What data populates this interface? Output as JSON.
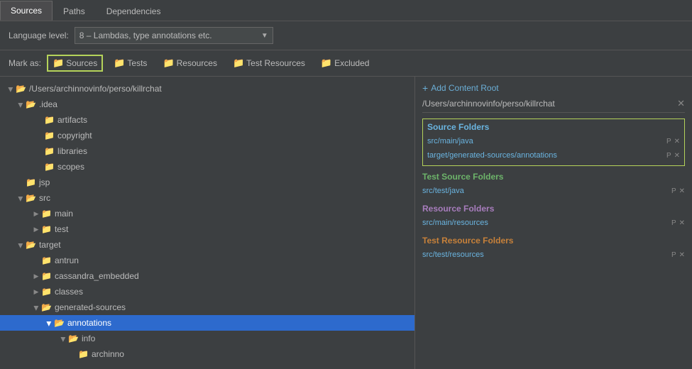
{
  "tabs": [
    {
      "label": "Sources",
      "active": true
    },
    {
      "label": "Paths",
      "active": false
    },
    {
      "label": "Dependencies",
      "active": false
    }
  ],
  "language": {
    "label": "Language level:",
    "value": "8 – Lambdas, type annotations etc."
  },
  "mark_as": {
    "label": "Mark as:",
    "buttons": [
      {
        "id": "sources",
        "label": "Sources",
        "active": true
      },
      {
        "id": "tests",
        "label": "Tests",
        "active": false
      },
      {
        "id": "resources",
        "label": "Resources",
        "active": false
      },
      {
        "id": "test_resources",
        "label": "Test Resources",
        "active": false
      },
      {
        "id": "excluded",
        "label": "Excluded",
        "active": false
      }
    ]
  },
  "tree": {
    "root": "/Users/archinnovinfo/perso/killrchat",
    "items": [
      {
        "id": "root",
        "label": "/Users/archinnovinfo/perso/killrchat",
        "indent": 8,
        "open": true,
        "type": "folder"
      },
      {
        "id": "idea",
        "label": ".idea",
        "indent": 28,
        "open": true,
        "type": "folder"
      },
      {
        "id": "artifacts",
        "label": "artifacts",
        "indent": 48,
        "open": false,
        "type": "folder-leaf"
      },
      {
        "id": "copyright",
        "label": "copyright",
        "indent": 48,
        "open": false,
        "type": "folder-leaf"
      },
      {
        "id": "libraries",
        "label": "libraries",
        "indent": 48,
        "open": false,
        "type": "folder-leaf"
      },
      {
        "id": "scopes",
        "label": "scopes",
        "indent": 48,
        "open": false,
        "type": "folder-leaf"
      },
      {
        "id": "jsp",
        "label": "jsp",
        "indent": 28,
        "open": false,
        "type": "folder-leaf"
      },
      {
        "id": "src",
        "label": "src",
        "indent": 28,
        "open": true,
        "type": "folder"
      },
      {
        "id": "main",
        "label": "main",
        "indent": 48,
        "open": false,
        "type": "folder"
      },
      {
        "id": "test",
        "label": "test",
        "indent": 48,
        "open": false,
        "type": "folder"
      },
      {
        "id": "target",
        "label": "target",
        "indent": 28,
        "open": true,
        "type": "folder"
      },
      {
        "id": "antrun",
        "label": "antrun",
        "indent": 48,
        "open": false,
        "type": "folder-leaf"
      },
      {
        "id": "cassandra_embedded",
        "label": "cassandra_embedded",
        "indent": 48,
        "open": false,
        "type": "folder"
      },
      {
        "id": "classes",
        "label": "classes",
        "indent": 48,
        "open": false,
        "type": "folder"
      },
      {
        "id": "generated-sources",
        "label": "generated-sources",
        "indent": 48,
        "open": true,
        "type": "folder"
      },
      {
        "id": "annotations",
        "label": "annotations",
        "indent": 68,
        "open": true,
        "type": "folder",
        "selected": true
      },
      {
        "id": "info",
        "label": "info",
        "indent": 88,
        "open": true,
        "type": "folder"
      },
      {
        "id": "archinno",
        "label": "archinno",
        "indent": 104,
        "open": false,
        "type": "folder"
      }
    ]
  },
  "right_panel": {
    "add_content_root": "+ Add Content Root",
    "content_root_path": "/Users/archinnovinfo/perso/killrchat",
    "sections": {
      "source_folders": {
        "title": "Source Folders",
        "paths": [
          "src/main/java",
          "target/generated-sources/annotations"
        ]
      },
      "test_source_folders": {
        "title": "Test Source Folders",
        "paths": [
          "src/test/java"
        ]
      },
      "resource_folders": {
        "title": "Resource Folders",
        "paths": [
          "src/main/resources"
        ]
      },
      "test_resource_folders": {
        "title": "Test Resource Folders",
        "paths": [
          "src/test/resources"
        ]
      }
    }
  }
}
